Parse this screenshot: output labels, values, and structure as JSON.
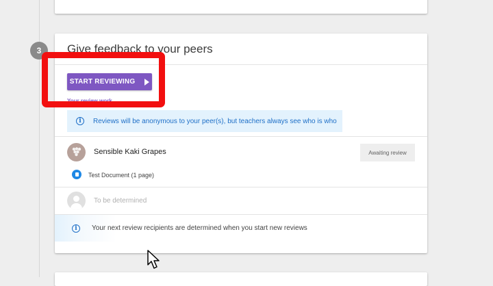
{
  "step": {
    "number": "3",
    "title": "Give feedback to your peers"
  },
  "actions": {
    "start_label": "START REVIEWING",
    "review_work_label": "Your review work"
  },
  "anonymity_notice": "Reviews will be anonymous to your peer(s), but teachers always see who is who",
  "peer": {
    "name": "Sensible Kaki Grapes",
    "status": "Awaiting review",
    "document": "Test Document (1 page)"
  },
  "pending": {
    "label": "To be determined"
  },
  "next_notice": "Your next review recipients are determined when you start new reviews",
  "icons": {
    "play": "play-icon",
    "info": "info-icon",
    "doc": "document-icon",
    "avatar": "grapes-avatar",
    "placeholder": "person-placeholder-icon",
    "cursor": "mouse-cursor"
  },
  "colors": {
    "accent": "#7e57c2",
    "info": "#1e6fc7",
    "highlight": "#f20f0f"
  }
}
